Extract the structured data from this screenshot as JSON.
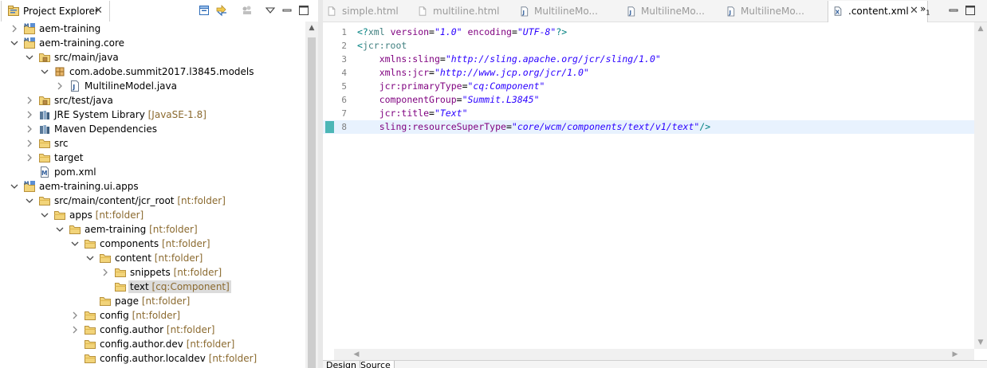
{
  "explorer": {
    "title": "Project Explorer",
    "close_glyph": "✕",
    "tools": [
      "collapse-all-icon",
      "link-with-editor-icon",
      "filters-icon",
      "view-menu-icon",
      "maximize-icon"
    ]
  },
  "tree": [
    {
      "label": "aem-training",
      "deco": "",
      "icon": "maven-project-icon",
      "expanded": false,
      "has_children": true
    },
    {
      "label": "aem-training.core",
      "deco": "",
      "icon": "maven-project-icon",
      "expanded": true,
      "has_children": true
    },
    {
      "label": "src/main/java",
      "deco": "",
      "icon": "source-folder-icon",
      "expanded": true,
      "has_children": true
    },
    {
      "label": "com.adobe.summit2017.l3845.models",
      "deco": "",
      "icon": "package-icon",
      "expanded": true,
      "has_children": true
    },
    {
      "label": "MultilineModel.java",
      "deco": "",
      "icon": "java-file-icon",
      "expanded": false,
      "has_children": true
    },
    {
      "label": "src/test/java",
      "deco": "",
      "icon": "source-folder-icon",
      "expanded": false,
      "has_children": true
    },
    {
      "label": "JRE System Library",
      "deco": "[JavaSE-1.8]",
      "icon": "library-icon",
      "expanded": false,
      "has_children": true
    },
    {
      "label": "Maven Dependencies",
      "deco": "",
      "icon": "library-icon",
      "expanded": false,
      "has_children": true
    },
    {
      "label": "src",
      "deco": "",
      "icon": "folder-icon",
      "expanded": false,
      "has_children": true
    },
    {
      "label": "target",
      "deco": "",
      "icon": "folder-icon",
      "expanded": false,
      "has_children": true
    },
    {
      "label": "pom.xml",
      "deco": "",
      "icon": "pom-file-icon",
      "expanded": false,
      "has_children": false
    },
    {
      "label": "aem-training.ui.apps",
      "deco": "",
      "icon": "maven-project-icon",
      "expanded": true,
      "has_children": true
    },
    {
      "label": "src/main/content/jcr_root",
      "deco": "[nt:folder]",
      "icon": "folder-icon",
      "expanded": true,
      "has_children": true
    },
    {
      "label": "apps",
      "deco": "[nt:folder]",
      "icon": "folder-icon",
      "expanded": true,
      "has_children": true
    },
    {
      "label": "aem-training",
      "deco": "[nt:folder]",
      "icon": "folder-icon",
      "expanded": true,
      "has_children": true
    },
    {
      "label": "components",
      "deco": "[nt:folder]",
      "icon": "folder-icon",
      "expanded": true,
      "has_children": true
    },
    {
      "label": "content",
      "deco": "[nt:folder]",
      "icon": "folder-icon",
      "expanded": true,
      "has_children": true
    },
    {
      "label": "snippets",
      "deco": "[nt:folder]",
      "icon": "folder-icon",
      "expanded": false,
      "has_children": true
    },
    {
      "label": "text",
      "deco": "[cq:Component]",
      "icon": "folder-icon",
      "expanded": false,
      "has_children": false,
      "selected": true
    },
    {
      "label": "page",
      "deco": "[nt:folder]",
      "icon": "folder-icon",
      "expanded": false,
      "has_children": false
    },
    {
      "label": "config",
      "deco": "[nt:folder]",
      "icon": "folder-icon",
      "expanded": false,
      "has_children": true
    },
    {
      "label": "config.author",
      "deco": "[nt:folder]",
      "icon": "folder-icon",
      "expanded": false,
      "has_children": true
    },
    {
      "label": "config.author.dev",
      "deco": "[nt:folder]",
      "icon": "folder-icon",
      "expanded": false,
      "has_children": false
    },
    {
      "label": "config.author.localdev",
      "deco": "[nt:folder]",
      "icon": "folder-icon",
      "expanded": false,
      "has_children": false
    }
  ],
  "editor": {
    "tabs": [
      {
        "label": "simple.html",
        "icon": "html-file-icon",
        "active": false
      },
      {
        "label": "multiline.html",
        "icon": "html-file-icon",
        "active": false
      },
      {
        "label": "MultilineMo...",
        "icon": "java-file-icon",
        "active": false
      },
      {
        "label": "MultilineMo...",
        "icon": "java-file-icon",
        "active": false
      },
      {
        "label": "MultilineMo...",
        "icon": "java-file-icon",
        "active": false
      },
      {
        "label": ".content.xml",
        "icon": "xml-file-icon",
        "active": true
      }
    ],
    "overflow_label": "»",
    "overflow_count": "1",
    "close_glyph": "✕",
    "current_line": 8,
    "lines": [
      {
        "n": "1",
        "tokens": [
          [
            "punct",
            "<?"
          ],
          [
            "tag",
            "xml"
          ],
          [
            "plain",
            " "
          ],
          [
            "attr",
            "version"
          ],
          [
            "eq",
            "="
          ],
          [
            "val",
            "\"1.0\""
          ],
          [
            "plain",
            " "
          ],
          [
            "attr",
            "encoding"
          ],
          [
            "eq",
            "="
          ],
          [
            "val",
            "\"UTF-8\""
          ],
          [
            "punct",
            "?>"
          ]
        ]
      },
      {
        "n": "2",
        "tokens": [
          [
            "punct",
            "<"
          ],
          [
            "tag",
            "jcr:root"
          ]
        ]
      },
      {
        "n": "3",
        "tokens": [
          [
            "plain",
            "    "
          ],
          [
            "attr",
            "xmlns:sling"
          ],
          [
            "eq",
            "="
          ],
          [
            "val",
            "\"http://sling.apache.org/jcr/sling/1.0\""
          ]
        ]
      },
      {
        "n": "4",
        "tokens": [
          [
            "plain",
            "    "
          ],
          [
            "attr",
            "xmlns:jcr"
          ],
          [
            "eq",
            "="
          ],
          [
            "val",
            "\"http://www.jcp.org/jcr/1.0\""
          ]
        ]
      },
      {
        "n": "5",
        "tokens": [
          [
            "plain",
            "    "
          ],
          [
            "attr",
            "jcr:primaryType"
          ],
          [
            "eq",
            "="
          ],
          [
            "val",
            "\"cq:Component\""
          ]
        ]
      },
      {
        "n": "6",
        "tokens": [
          [
            "plain",
            "    "
          ],
          [
            "attr",
            "componentGroup"
          ],
          [
            "eq",
            "="
          ],
          [
            "val",
            "\"Summit.L3845\""
          ]
        ]
      },
      {
        "n": "7",
        "tokens": [
          [
            "plain",
            "    "
          ],
          [
            "attr",
            "jcr:title"
          ],
          [
            "eq",
            "="
          ],
          [
            "val",
            "\"Text\""
          ]
        ]
      },
      {
        "n": "8",
        "tokens": [
          [
            "plain",
            "    "
          ],
          [
            "attr",
            "sling:resourceSuperType"
          ],
          [
            "eq",
            "="
          ],
          [
            "val",
            "\"core/wcm/components/text/v1/text\""
          ],
          [
            "punct",
            "/>"
          ]
        ]
      }
    ],
    "bottom_tabs": [
      "Design",
      "Source"
    ]
  },
  "colors": {
    "folder": "#e8c15a",
    "selection": "#dcdcdc",
    "current_line": "#e8f2fe",
    "marker": "#4cb6b6"
  }
}
